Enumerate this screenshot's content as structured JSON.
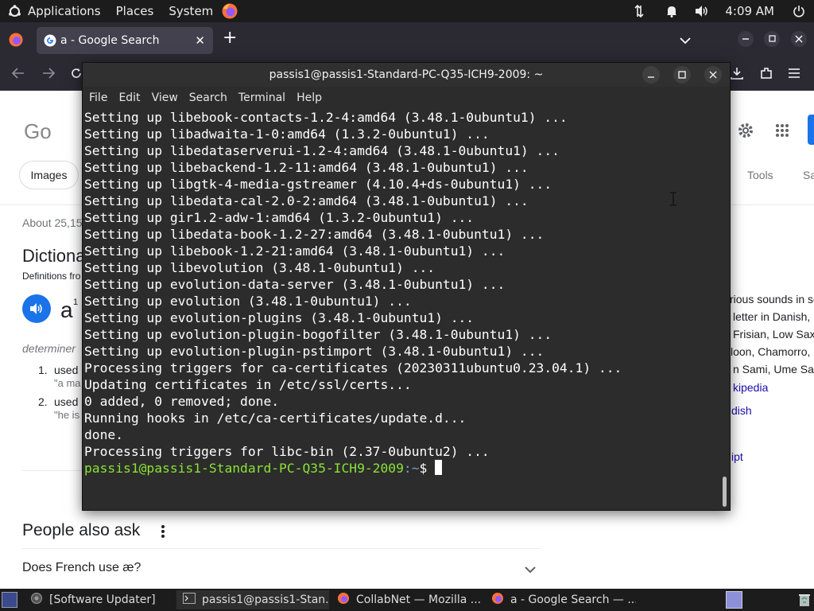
{
  "top_panel": {
    "menus": [
      "Applications",
      "Places",
      "System"
    ],
    "clock": "4:09 AM"
  },
  "firefox": {
    "tab_title": "a - Google Search"
  },
  "google": {
    "filter_images": "Images",
    "tools": "Tools",
    "tools_partial": "Sa",
    "result_count": "About 25,15",
    "dictionary_heading": "Dictiona",
    "definitions_from": "Definitions fro",
    "word": "a",
    "word_sup": "1",
    "pos": "determiner",
    "def1_num": "1.",
    "def1_text": "used",
    "def1_example": "\"a ma",
    "def2_num": "2.",
    "def2_text": "used",
    "def2_example": "\"he is",
    "right_lines": [
      "rious sounds in so",
      "letter in Danish,",
      "Frisian, Low Sax",
      "loon, Chamorro, I",
      "n Sami, Ume Sar"
    ],
    "right_links": [
      "kipedia",
      "dish",
      "ipt"
    ],
    "people_also_ask": "People also ask",
    "paa_question": "Does French use æ?"
  },
  "terminal": {
    "title": "passis1@passis1-Standard-PC-Q35-ICH9-2009: ~",
    "menu": [
      "File",
      "Edit",
      "View",
      "Search",
      "Terminal",
      "Help"
    ],
    "lines": [
      "Setting up libebook-contacts-1.2-4:amd64 (3.48.1-0ubuntu1) ...",
      "Setting up libadwaita-1-0:amd64 (1.3.2-0ubuntu1) ...",
      "Setting up libedataserverui-1.2-4:amd64 (3.48.1-0ubuntu1) ...",
      "Setting up libebackend-1.2-11:amd64 (3.48.1-0ubuntu1) ...",
      "Setting up libgtk-4-media-gstreamer (4.10.4+ds-0ubuntu1) ...",
      "Setting up libedata-cal-2.0-2:amd64 (3.48.1-0ubuntu1) ...",
      "Setting up gir1.2-adw-1:amd64 (1.3.2-0ubuntu1) ...",
      "Setting up libedata-book-1.2-27:amd64 (3.48.1-0ubuntu1) ...",
      "Setting up libebook-1.2-21:amd64 (3.48.1-0ubuntu1) ...",
      "Setting up libevolution (3.48.1-0ubuntu1) ...",
      "Setting up evolution-data-server (3.48.1-0ubuntu1) ...",
      "Setting up evolution (3.48.1-0ubuntu1) ...",
      "Setting up evolution-plugins (3.48.1-0ubuntu1) ...",
      "Setting up evolution-plugin-bogofilter (3.48.1-0ubuntu1) ...",
      "Setting up evolution-plugin-pstimport (3.48.1-0ubuntu1) ...",
      "Processing triggers for ca-certificates (20230311ubuntu0.23.04.1) ...",
      "Updating certificates in /etc/ssl/certs...",
      "0 added, 0 removed; done.",
      "Running hooks in /etc/ca-certificates/update.d...",
      "done.",
      "Processing triggers for libc-bin (2.37-0ubuntu2) ..."
    ],
    "prompt_user": "passis1@passis1-Standard-PC-Q35-ICH9-2009",
    "prompt_path": ":~",
    "prompt_symbol": "$ "
  },
  "taskbar": {
    "items": [
      "[Software Updater]",
      "passis1@passis1-Stan...",
      "CollabNet — Mozilla ...",
      "a - Google Search — ..."
    ]
  },
  "colors": {
    "terminal_bg": "#2c2c2c",
    "prompt_user": "#8ae234",
    "prompt_path": "#729fcf",
    "google_blue": "#1a73e8",
    "link_blue": "#1a0dab"
  }
}
